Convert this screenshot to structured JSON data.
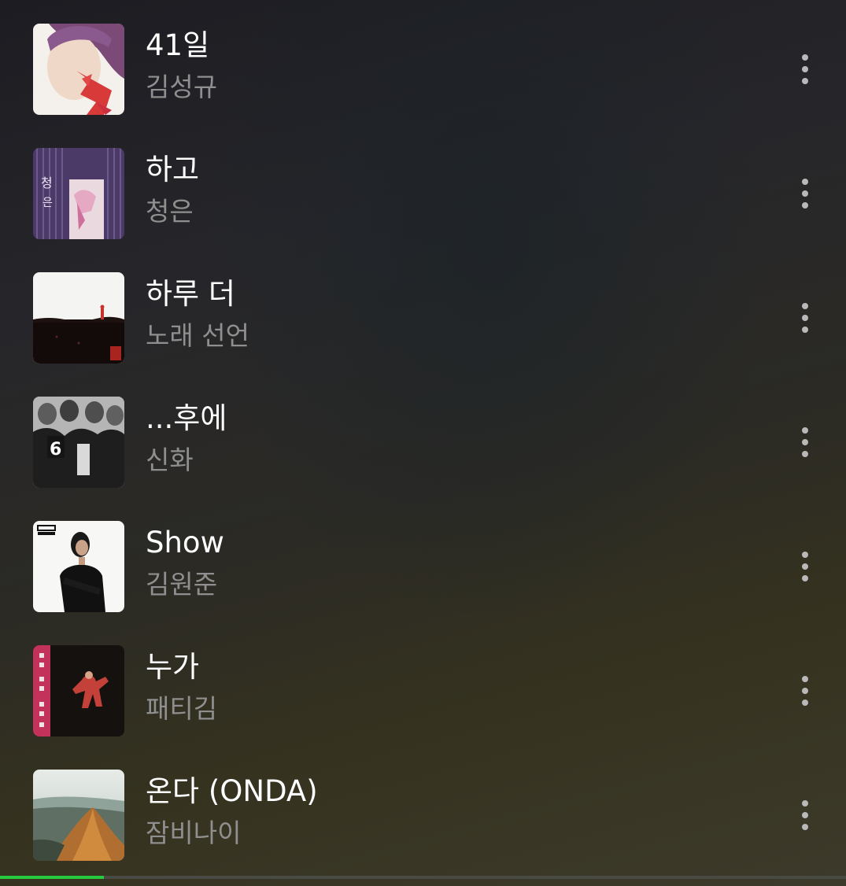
{
  "tracks": [
    {
      "title": "41일",
      "artist": "김성규",
      "art": "album-art-kim-sungkyu"
    },
    {
      "title": "하고",
      "artist": "청은",
      "art": "album-art-cheongeun"
    },
    {
      "title": "하루 더",
      "artist": "노래 선언",
      "art": "album-art-norae-seoneon"
    },
    {
      "title": "...후에",
      "artist": "신화",
      "art": "album-art-shinhwa"
    },
    {
      "title": "Show",
      "artist": "김원준",
      "art": "album-art-kim-wonjun"
    },
    {
      "title": "누가",
      "artist": "패티김",
      "art": "album-art-patti-kim"
    },
    {
      "title": "온다 (ONDA)",
      "artist": "잠비나이",
      "art": "album-art-jambinai"
    }
  ],
  "more_icon": "more-vertical-icon",
  "progress": {
    "fraction": 0.123,
    "color": "#27c93f"
  }
}
